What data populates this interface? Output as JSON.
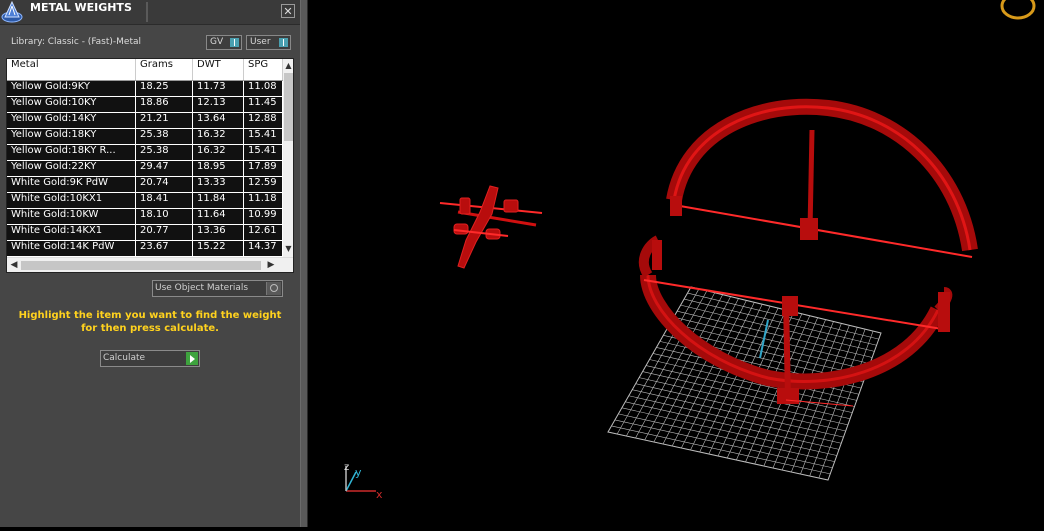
{
  "panel": {
    "title": "METAL WEIGHTS",
    "close_label": "✕",
    "library_label": "Library: Classic - (Fast)-Metal",
    "toggles": [
      {
        "label": "GV"
      },
      {
        "label": "User"
      }
    ],
    "table": {
      "columns": [
        "Metal",
        "Grams",
        "DWT",
        "SPG"
      ],
      "rows": [
        [
          "Yellow Gold:9KY",
          "18.25",
          "11.73",
          "11.08"
        ],
        [
          "Yellow Gold:10KY",
          "18.86",
          "12.13",
          "11.45"
        ],
        [
          "Yellow Gold:14KY",
          "21.21",
          "13.64",
          "12.88"
        ],
        [
          "Yellow Gold:18KY",
          "25.38",
          "16.32",
          "15.41"
        ],
        [
          "Yellow Gold:18KY R...",
          "25.38",
          "16.32",
          "15.41"
        ],
        [
          "Yellow Gold:22KY",
          "29.47",
          "18.95",
          "17.89"
        ],
        [
          "White Gold:9K PdW",
          "20.74",
          "13.33",
          "12.59"
        ],
        [
          "White Gold:10KX1",
          "18.41",
          "11.84",
          "11.18"
        ],
        [
          "White Gold:10KW",
          "18.10",
          "11.64",
          "10.99"
        ],
        [
          "White Gold:14KX1",
          "20.77",
          "13.36",
          "12.61"
        ],
        [
          "White Gold:14K PdW",
          "23.67",
          "15.22",
          "14.37"
        ]
      ]
    },
    "use_object_label": "Use Object Materials",
    "hint_line1": "Highlight the item you want to find the weight",
    "hint_line2": "for then press calculate.",
    "calculate_label": "Calculate"
  },
  "viewport": {
    "axis_x": "x",
    "axis_y": "y",
    "axis_z": "z"
  },
  "colors": {
    "panel_bg": "#464646",
    "hint_text": "#ffd21e",
    "model_red": "#b80d0d",
    "grid": "#bdbdbd"
  }
}
